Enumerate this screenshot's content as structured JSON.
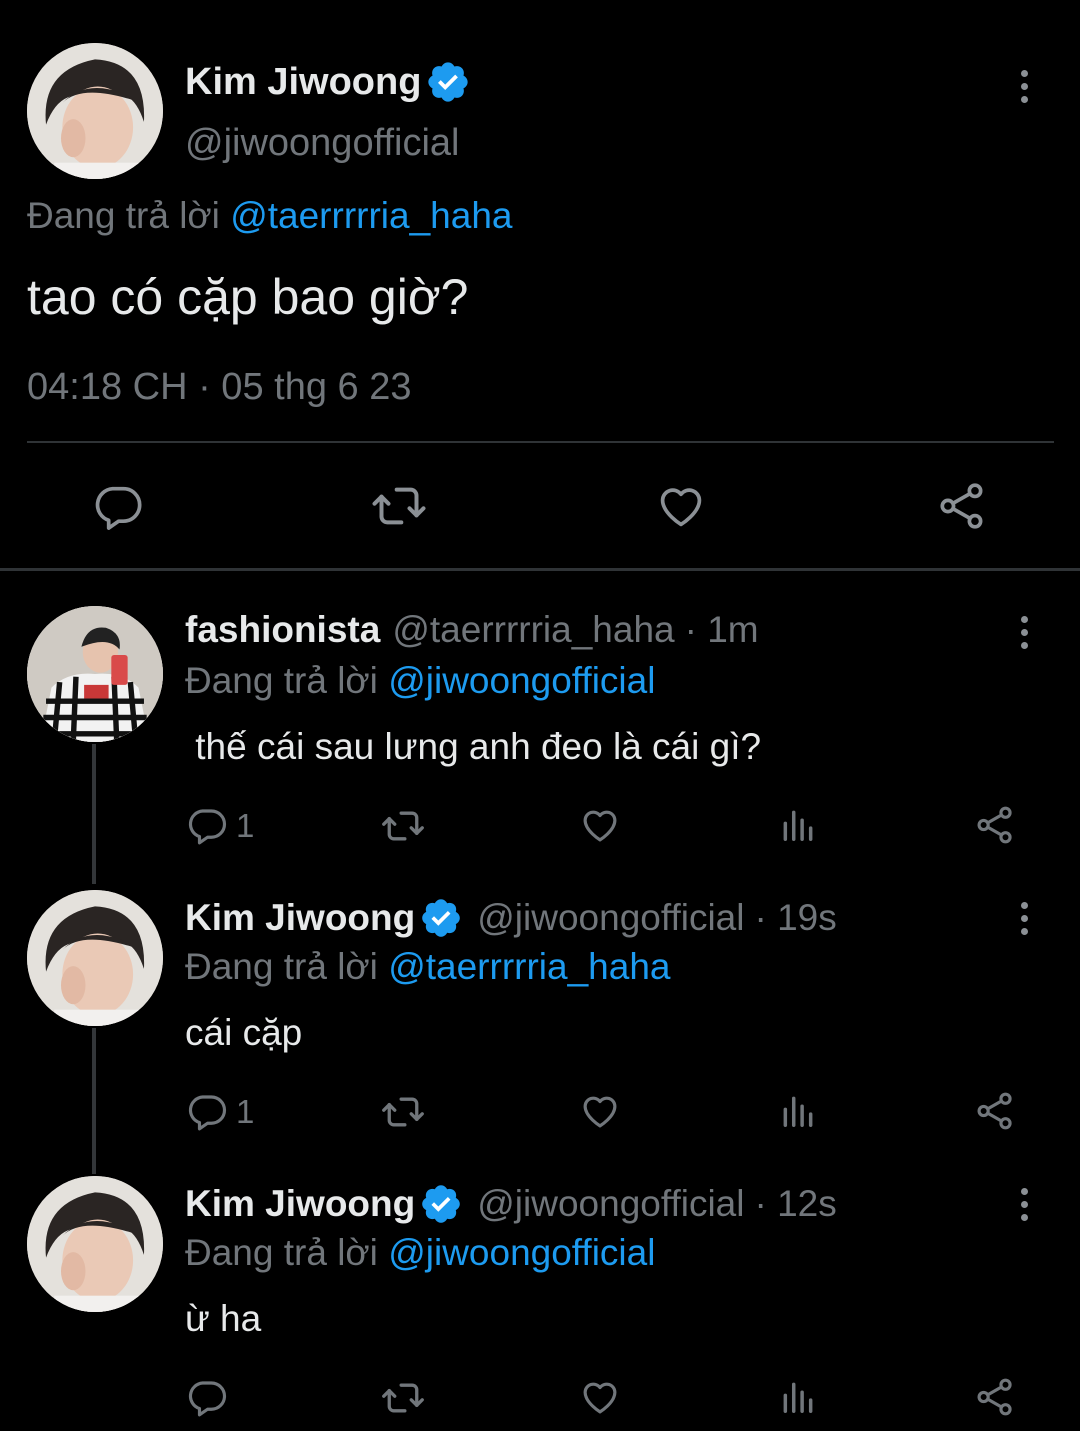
{
  "main_tweet": {
    "display_name": "Kim Jiwoong",
    "handle": "@jiwoongofficial",
    "reply_prefix": "Đang trả lời",
    "reply_to": "@taerrrrria_haha",
    "text": "tao có cặp bao giờ?",
    "timestamp": "04:18 CH · 05 thg 6 23",
    "actions": [
      "reply-icon",
      "retweet-icon",
      "like-icon",
      "share-icon"
    ]
  },
  "replies": [
    {
      "display_name": "fashionista",
      "handle": "@taerrrrria_haha",
      "time": "· 1m",
      "verified": false,
      "reply_prefix": "Đang trả lời",
      "reply_to": "@jiwoongofficial",
      "text": " thế cái sau lưng anh đeo là cái gì?",
      "reply_count": "1"
    },
    {
      "display_name": "Kim Jiwoong",
      "handle": "@jiwoongofficial",
      "time": "· 19s",
      "verified": true,
      "reply_prefix": "Đang trả lời",
      "reply_to": "@taerrrrria_haha",
      "text": "cái cặp",
      "reply_count": "1"
    },
    {
      "display_name": "Kim Jiwoong",
      "handle": "@jiwoongofficial",
      "time": "· 12s",
      "verified": true,
      "reply_prefix": "Đang trả lời",
      "reply_to": "@jiwoongofficial",
      "text": "ừ ha",
      "reply_count": ""
    }
  ],
  "colors": {
    "background": "#000000",
    "text": "#e7e9ea",
    "muted": "#71767b",
    "link": "#1d9bf0",
    "verified": "#1d9bf0",
    "divider": "#2f3336"
  }
}
